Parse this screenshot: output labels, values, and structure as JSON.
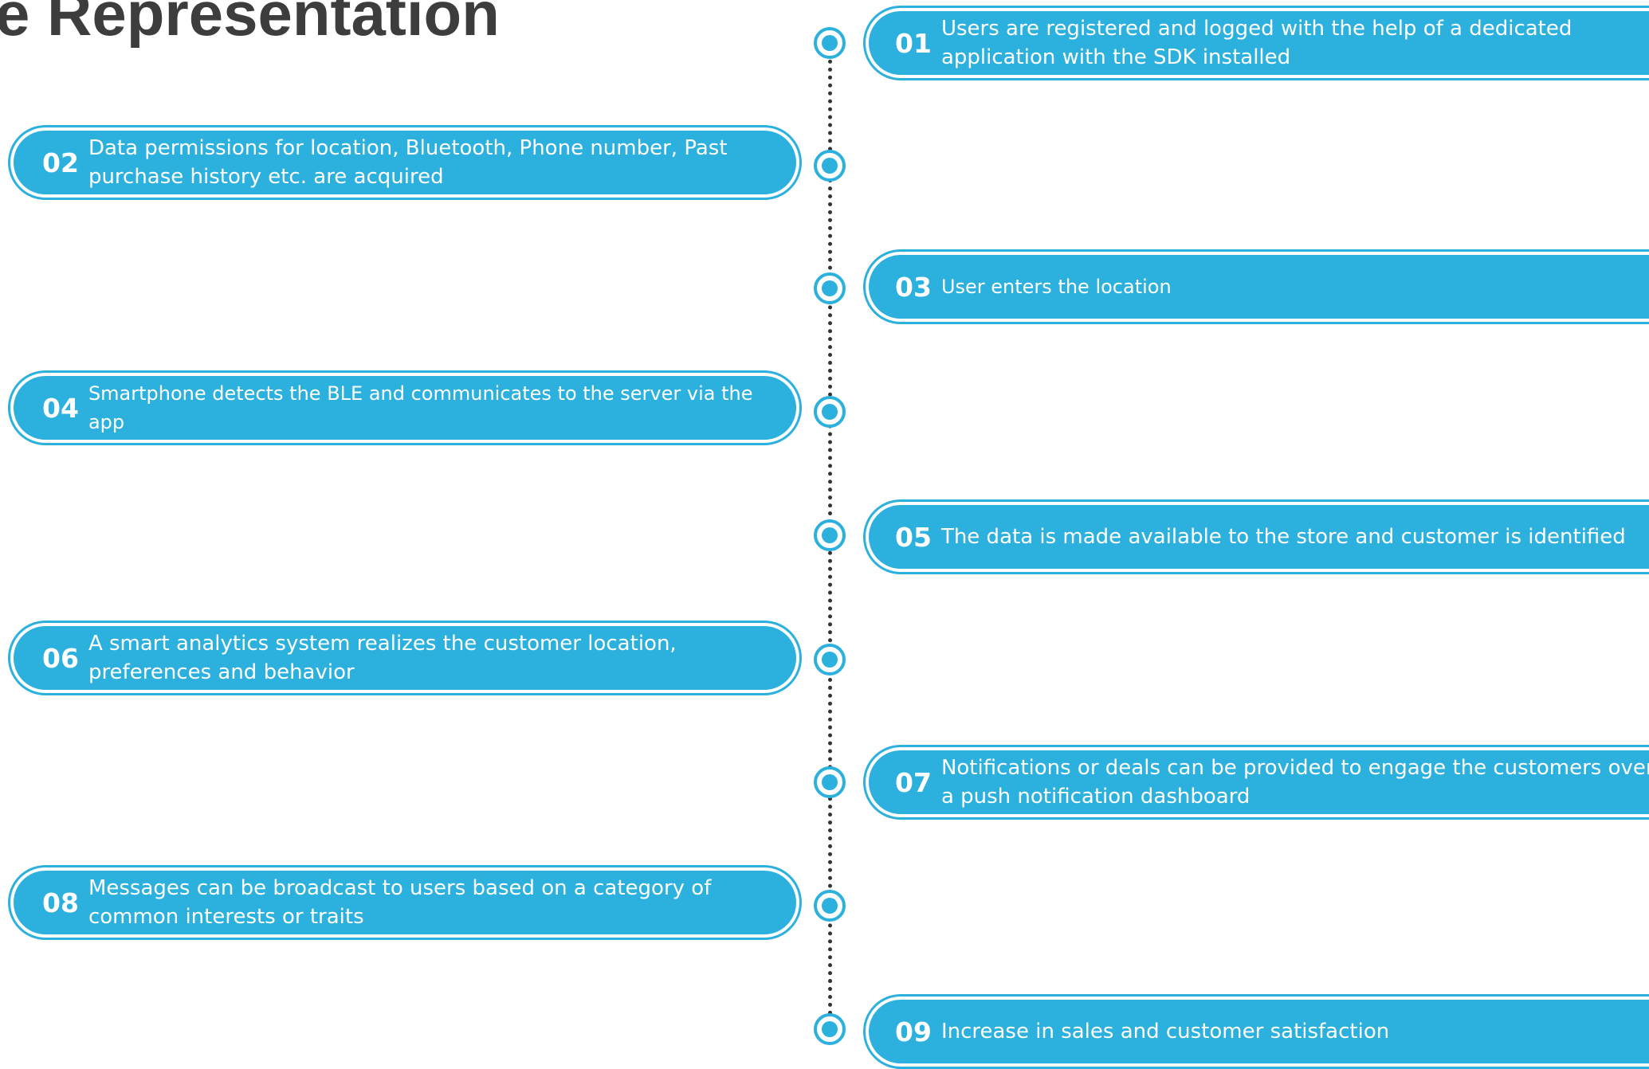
{
  "title": "e Representation",
  "steps": [
    {
      "num": "01",
      "text": "Users are registered and logged with the help of a dedicated application with the SDK installed"
    },
    {
      "num": "02",
      "text": "Data permissions for location, Bluetooth, Phone number, Past purchase history etc. are acquired"
    },
    {
      "num": "03",
      "text": "User enters the location"
    },
    {
      "num": "04",
      "text": "Smartphone detects the BLE and communicates to the server via the app"
    },
    {
      "num": "05",
      "text": "The data is made available to the store and customer is identified"
    },
    {
      "num": "06",
      "text": "A smart analytics system realizes the customer location, preferences and behavior"
    },
    {
      "num": "07",
      "text": "Notifications or deals can be provided to engage the customers over a push notification dashboard"
    },
    {
      "num": "08",
      "text": "Messages can be broadcast to users based on a category of common interests or traits"
    },
    {
      "num": "09",
      "text": "Increase in sales and customer satisfaction"
    }
  ],
  "colors": {
    "accent": "#2cb0de",
    "title": "#3d3d3d",
    "timeline": "#333333"
  }
}
